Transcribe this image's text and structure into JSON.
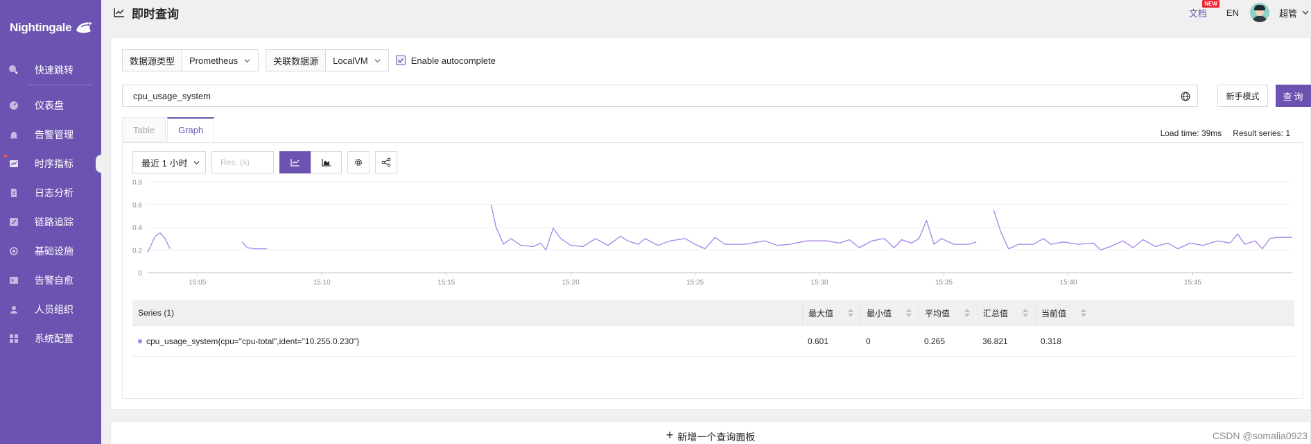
{
  "brand": {
    "name": "Nightingale"
  },
  "sidebar": {
    "search_label": "快速跳转",
    "items": [
      {
        "label": "仪表盘",
        "icon": "dashboard-icon"
      },
      {
        "label": "告警管理",
        "icon": "alert-bell-icon"
      },
      {
        "label": "时序指标",
        "icon": "metric-chart-icon"
      },
      {
        "label": "日志分析",
        "icon": "log-file-icon"
      },
      {
        "label": "链路追踪",
        "icon": "trace-icon"
      },
      {
        "label": "基础设施",
        "icon": "infra-icon"
      },
      {
        "label": "告警自愈",
        "icon": "terminal-icon"
      },
      {
        "label": "人员组织",
        "icon": "user-icon"
      },
      {
        "label": "系统配置",
        "icon": "settings-grid-icon"
      }
    ],
    "active_index": 2
  },
  "header": {
    "title": "即时查询",
    "doc_label": "文档",
    "new_badge": "NEW",
    "lang": "EN",
    "user": "超管"
  },
  "datasource": {
    "type_label": "数据源类型",
    "type_value": "Prometheus",
    "source_label": "关联数据源",
    "source_value": "LocalVM",
    "autocomplete_label": "Enable autocomplete",
    "autocomplete_checked": true
  },
  "query": {
    "expression": "cpu_usage_system",
    "beginner_label": "新手模式",
    "submit_label": "查询"
  },
  "tabs": [
    {
      "label": "Table",
      "active": false
    },
    {
      "label": "Graph",
      "active": true
    }
  ],
  "load_info": {
    "load_time": "Load time: 39ms",
    "result_series": "Result series: 1"
  },
  "graph_toolbar": {
    "time_range": "最近 1 小时",
    "res_placeholder": "Res. (s)"
  },
  "series_table": {
    "columns": [
      "Series (1)",
      "最大值",
      "最小值",
      "平均值",
      "汇总值",
      "当前值"
    ],
    "rows": [
      {
        "series": "cpu_usage_system{cpu=\"cpu-total\",ident=\"10.255.0.230\"}",
        "max": "0.601",
        "min": "0",
        "avg": "0.265",
        "sum": "36.821",
        "current": "0.318"
      }
    ]
  },
  "add_panel_label": "新增一个查询面板",
  "watermark": "CSDN @somalia0923",
  "colors": {
    "accent": "#6c53b1",
    "line": "#a582ea"
  },
  "chart_data": {
    "type": "line",
    "y_ticks": [
      "0",
      "0.2",
      "0.4",
      "0.6",
      "0.8"
    ],
    "x_ticks": [
      "15:05",
      "15:10",
      "15:15",
      "15:20",
      "15:25",
      "15:30",
      "15:35",
      "15:40",
      "15:45"
    ],
    "ylim": [
      0,
      0.8
    ],
    "x_minutes_range": [
      "15:03",
      "15:49"
    ],
    "grid": true,
    "series": [
      {
        "segments": [
          [
            [
              "15:03.0",
              0.18
            ],
            [
              "15:03.3",
              0.32
            ],
            [
              "15:03.5",
              0.35
            ],
            [
              "15:03.7",
              0.3
            ],
            [
              "15:03.9",
              0.21
            ]
          ],
          [
            [
              "15:06.8",
              0.27
            ],
            [
              "15:07.0",
              0.22
            ],
            [
              "15:07.3",
              0.21
            ],
            [
              "15:07.8",
              0.21
            ]
          ],
          [
            [
              "15:16.8",
              0.6
            ],
            [
              "15:17.0",
              0.4
            ],
            [
              "15:17.3",
              0.25
            ],
            [
              "15:17.6",
              0.3
            ],
            [
              "15:18.0",
              0.24
            ],
            [
              "15:18.5",
              0.23
            ],
            [
              "15:18.8",
              0.26
            ],
            [
              "15:19.0",
              0.2
            ],
            [
              "15:19.3",
              0.39
            ],
            [
              "15:19.6",
              0.3
            ],
            [
              "15:20.0",
              0.24
            ],
            [
              "15:20.5",
              0.23
            ],
            [
              "15:21.0",
              0.3
            ],
            [
              "15:21.5",
              0.24
            ],
            [
              "15:22.0",
              0.32
            ],
            [
              "15:22.3",
              0.28
            ],
            [
              "15:22.7",
              0.25
            ],
            [
              "15:23.0",
              0.3
            ],
            [
              "15:23.5",
              0.24
            ],
            [
              "15:24.0",
              0.28
            ],
            [
              "15:24.6",
              0.3
            ],
            [
              "15:25.0",
              0.25
            ],
            [
              "15:25.4",
              0.21
            ],
            [
              "15:25.8",
              0.31
            ],
            [
              "15:26.2",
              0.25
            ],
            [
              "15:27.0",
              0.25
            ],
            [
              "15:27.8",
              0.28
            ],
            [
              "15:28.3",
              0.24
            ],
            [
              "15:28.8",
              0.25
            ],
            [
              "15:29.5",
              0.28
            ],
            [
              "15:30.3",
              0.28
            ],
            [
              "15:30.8",
              0.26
            ],
            [
              "15:31.2",
              0.29
            ],
            [
              "15:31.6",
              0.22
            ],
            [
              "15:32.1",
              0.28
            ],
            [
              "15:32.6",
              0.3
            ],
            [
              "15:33.0",
              0.22
            ],
            [
              "15:33.3",
              0.29
            ],
            [
              "15:33.7",
              0.26
            ],
            [
              "15:34.0",
              0.3
            ],
            [
              "15:34.3",
              0.46
            ],
            [
              "15:34.6",
              0.25
            ],
            [
              "15:34.9",
              0.3
            ],
            [
              "15:35.4",
              0.25
            ],
            [
              "15:36.0",
              0.25
            ],
            [
              "15:36.3",
              0.27
            ]
          ],
          [
            [
              "15:37.0",
              0.55
            ],
            [
              "15:37.3",
              0.35
            ],
            [
              "15:37.6",
              0.21
            ],
            [
              "15:38.0",
              0.25
            ],
            [
              "15:38.6",
              0.25
            ],
            [
              "15:39.0",
              0.3
            ],
            [
              "15:39.3",
              0.25
            ],
            [
              "15:39.8",
              0.27
            ],
            [
              "15:40.4",
              0.25
            ],
            [
              "15:41.0",
              0.26
            ],
            [
              "15:41.3",
              0.2
            ],
            [
              "15:41.7",
              0.23
            ],
            [
              "15:42.2",
              0.28
            ],
            [
              "15:42.6",
              0.22
            ],
            [
              "15:43.0",
              0.29
            ],
            [
              "15:43.5",
              0.23
            ],
            [
              "15:44.0",
              0.26
            ],
            [
              "15:44.4",
              0.21
            ],
            [
              "15:44.9",
              0.26
            ],
            [
              "15:45.4",
              0.24
            ],
            [
              "15:46.0",
              0.28
            ],
            [
              "15:46.5",
              0.26
            ],
            [
              "15:46.8",
              0.34
            ],
            [
              "15:47.1",
              0.25
            ],
            [
              "15:47.5",
              0.28
            ],
            [
              "15:47.8",
              0.21
            ],
            [
              "15:48.1",
              0.3
            ],
            [
              "15:48.4",
              0.31
            ],
            [
              "15:49.0",
              0.31
            ]
          ]
        ]
      }
    ]
  }
}
